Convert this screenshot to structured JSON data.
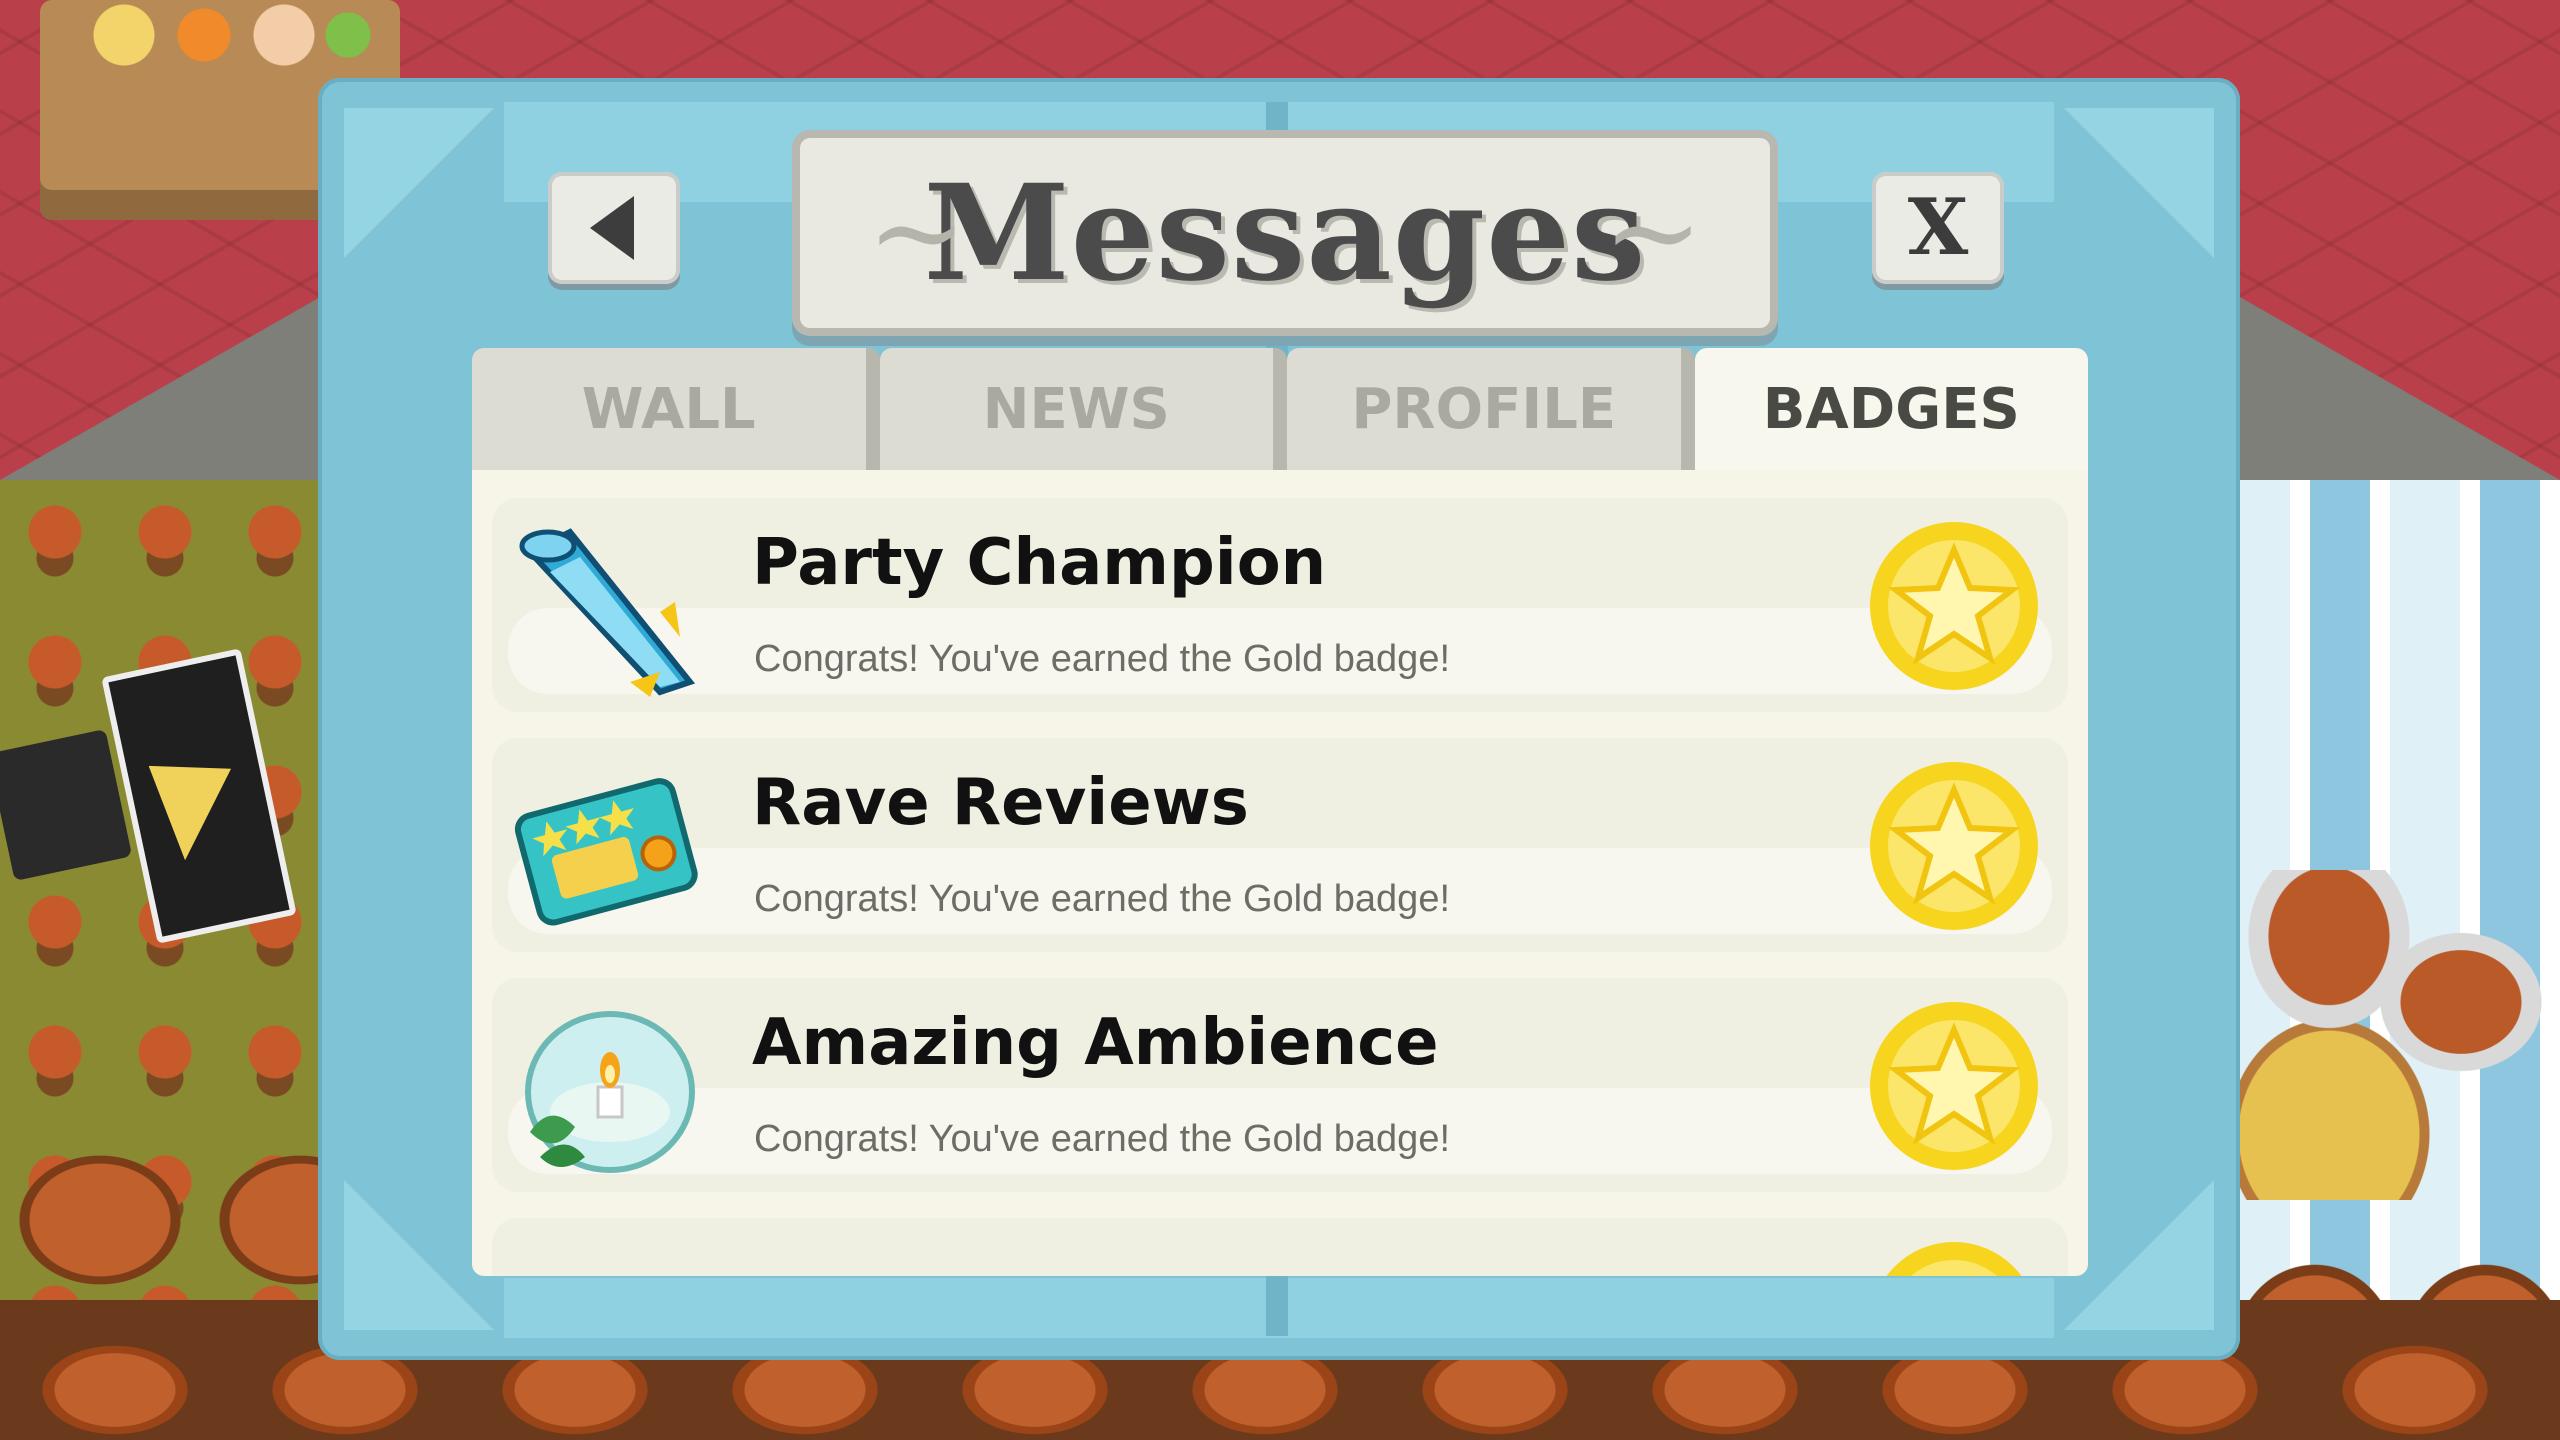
{
  "modal": {
    "title": "Messages",
    "back_button_icon": "back-arrow-icon",
    "close_label": "X"
  },
  "tabs": [
    {
      "label": "WALL",
      "active": false
    },
    {
      "label": "NEWS",
      "active": false
    },
    {
      "label": "PROFILE",
      "active": false
    },
    {
      "label": "BADGES",
      "active": true
    }
  ],
  "badges": [
    {
      "title": "Party Champion",
      "message": "Congrats! You've earned the Gold badge!",
      "icon": "party-horn-icon",
      "tier": "gold-star-badge"
    },
    {
      "title": "Rave Reviews",
      "message": "Congrats! You've earned the Gold badge!",
      "icon": "review-card-icon",
      "tier": "gold-star-badge"
    },
    {
      "title": "Amazing Ambience",
      "message": "Congrats! You've earned the Gold badge!",
      "icon": "candle-bowl-icon",
      "tier": "gold-star-badge"
    }
  ],
  "colors": {
    "frame": "#7ec3d6",
    "content_bg": "#f6f5e8",
    "badge_gold": "#f6d21e"
  }
}
